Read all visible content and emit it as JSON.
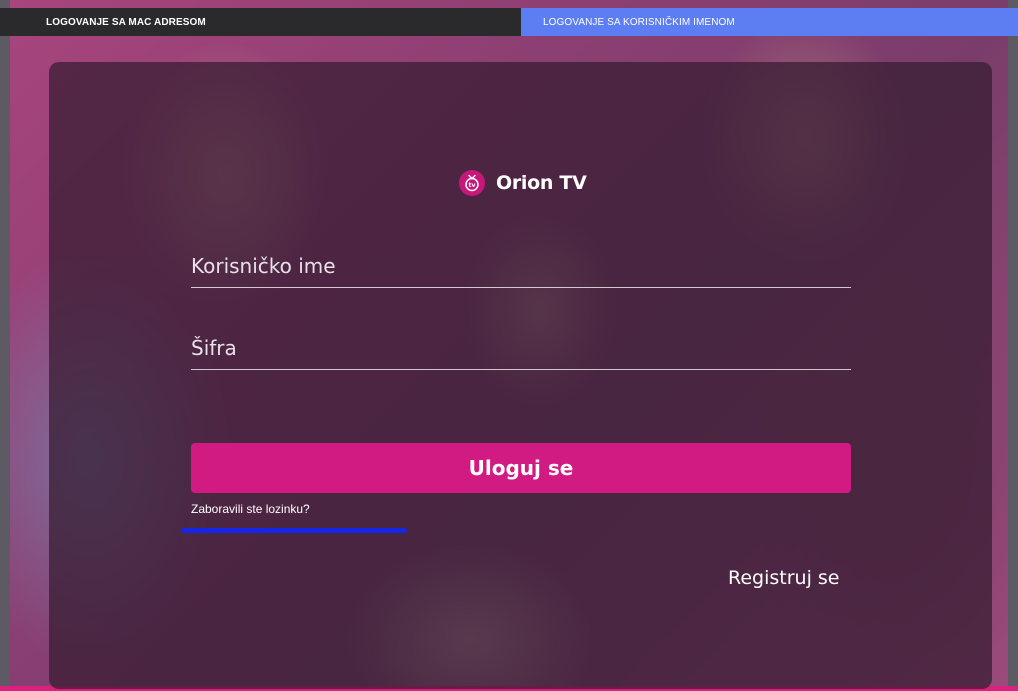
{
  "tabs": [
    {
      "label": "LOGOVANJE SA MAC ADRESOM",
      "active": false
    },
    {
      "label": "LOGOVANJE SA KORISNIČKIM IMENOM",
      "active": true
    }
  ],
  "brand": {
    "name": "Orion TV",
    "logo_icon": "tv-logo-icon",
    "logo_text": "tv",
    "color": "#d11b82"
  },
  "form": {
    "username_placeholder": "Korisničko ime",
    "username_value": "",
    "password_placeholder": "Šifra",
    "password_value": "",
    "login_label": "Uloguj se",
    "forgot_label": "Zaboravili ste lozinku?",
    "register_label": "Registruj se"
  },
  "colors": {
    "accent": "#d11b82",
    "active_tab": "#5d7df2",
    "inactive_tab": "#2a2a2c",
    "focus_highlight": "#1526e6"
  }
}
